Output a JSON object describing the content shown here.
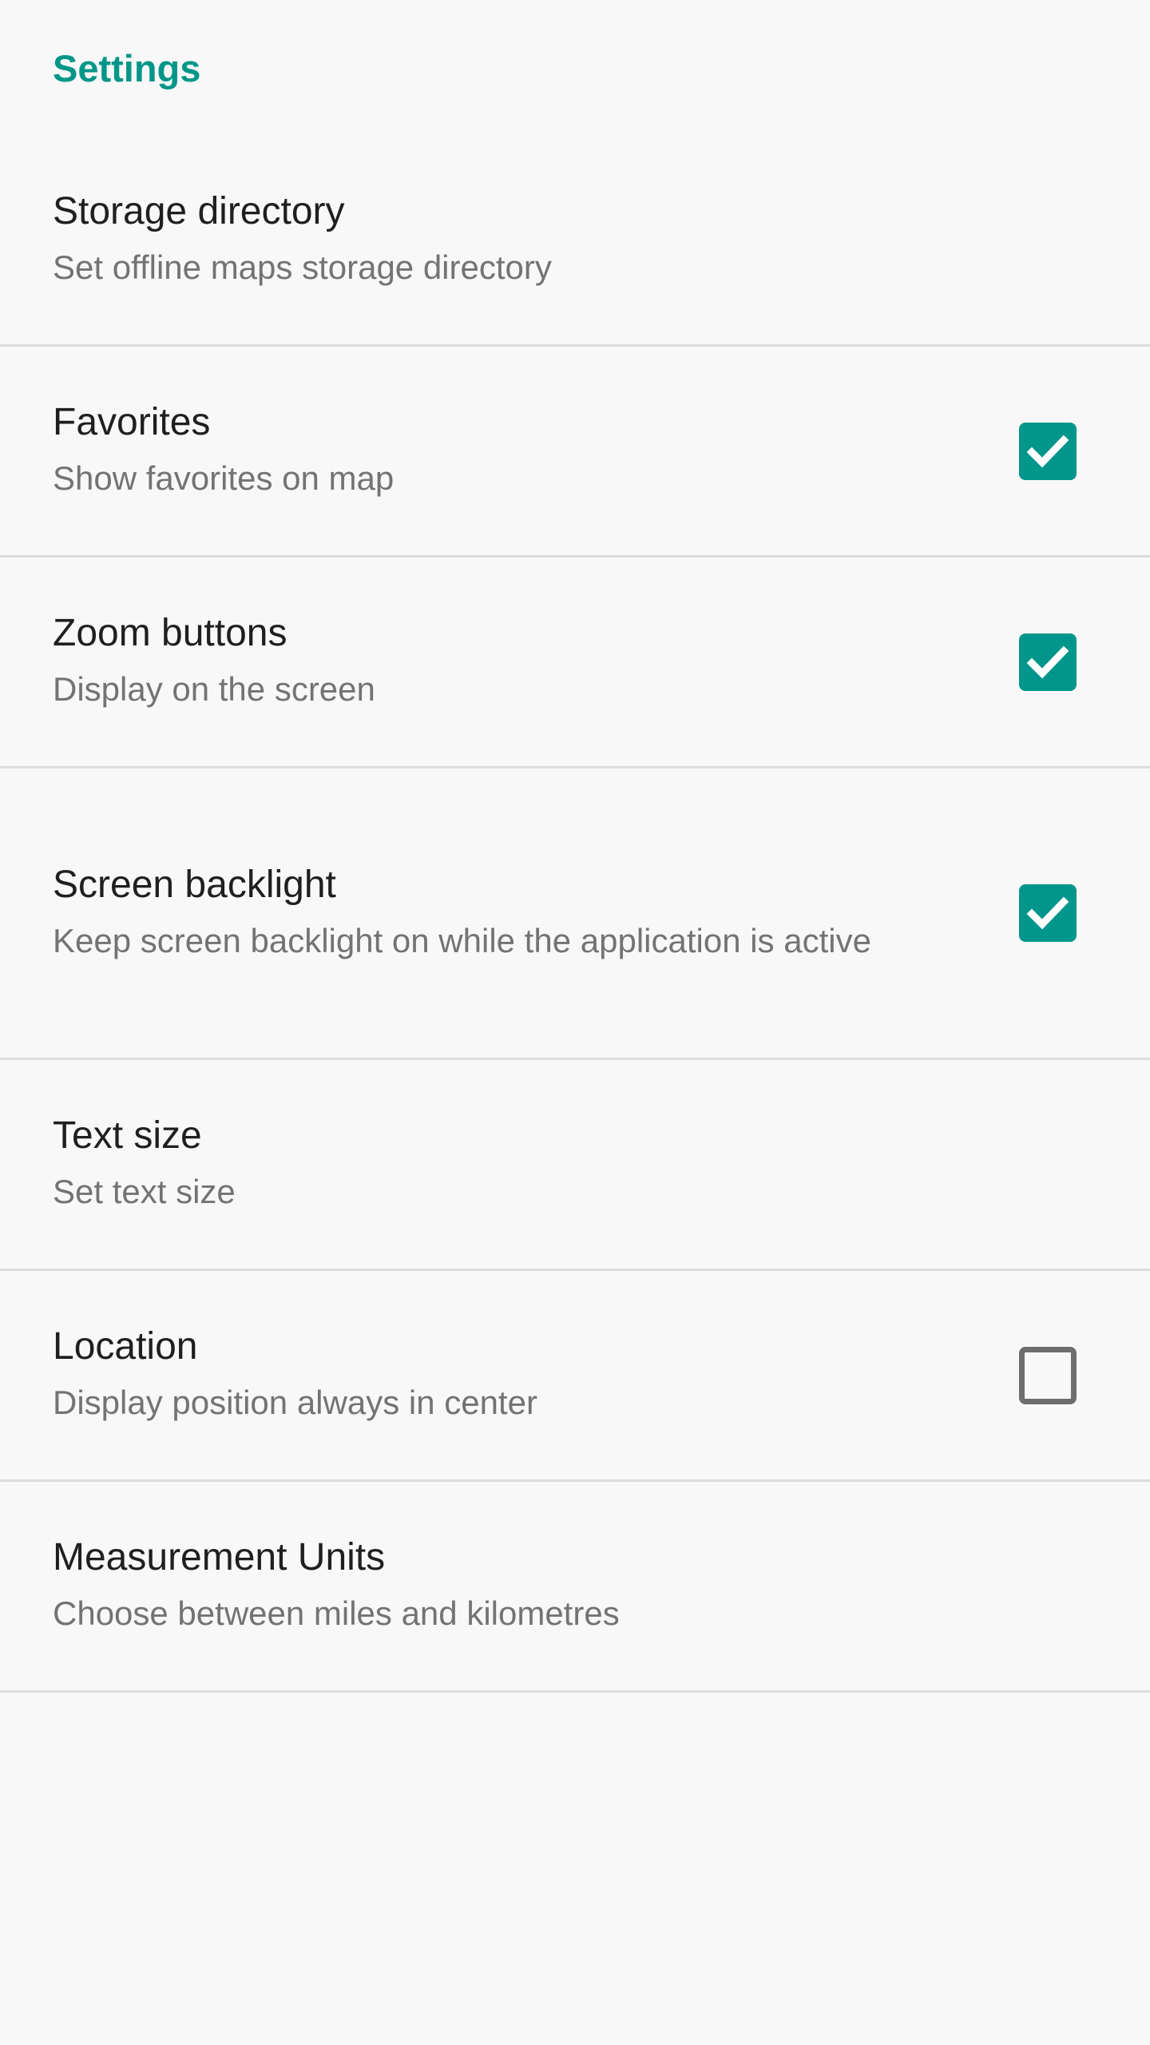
{
  "header": {
    "title": "Settings",
    "accent_color": "#009688"
  },
  "theme": {
    "background": "#f8f8f8",
    "divider": "#dcdcdc",
    "title_color": "#1f1f1f",
    "subtitle_color": "#737373",
    "checkbox_checked_fill": "#00968b",
    "checkbox_unchecked_border": "#6e6e6e",
    "checkmark_color": "#ffffff"
  },
  "settings": {
    "items": [
      {
        "title": "Storage directory",
        "subtitle": "Set offline maps storage directory",
        "control": "none",
        "checked": null
      },
      {
        "title": "Favorites",
        "subtitle": "Show favorites on map",
        "control": "checkbox",
        "checked": true
      },
      {
        "title": "Zoom buttons",
        "subtitle": "Display on the screen",
        "control": "checkbox",
        "checked": true
      },
      {
        "title": "Screen backlight",
        "subtitle": "Keep screen backlight on while the application is active",
        "control": "checkbox",
        "checked": true
      },
      {
        "title": "Text size",
        "subtitle": "Set text size",
        "control": "none",
        "checked": null
      },
      {
        "title": "Location",
        "subtitle": "Display position always in center",
        "control": "checkbox",
        "checked": false
      },
      {
        "title": "Measurement Units",
        "subtitle": "Choose between miles and kilometres",
        "control": "none",
        "checked": null
      }
    ]
  }
}
